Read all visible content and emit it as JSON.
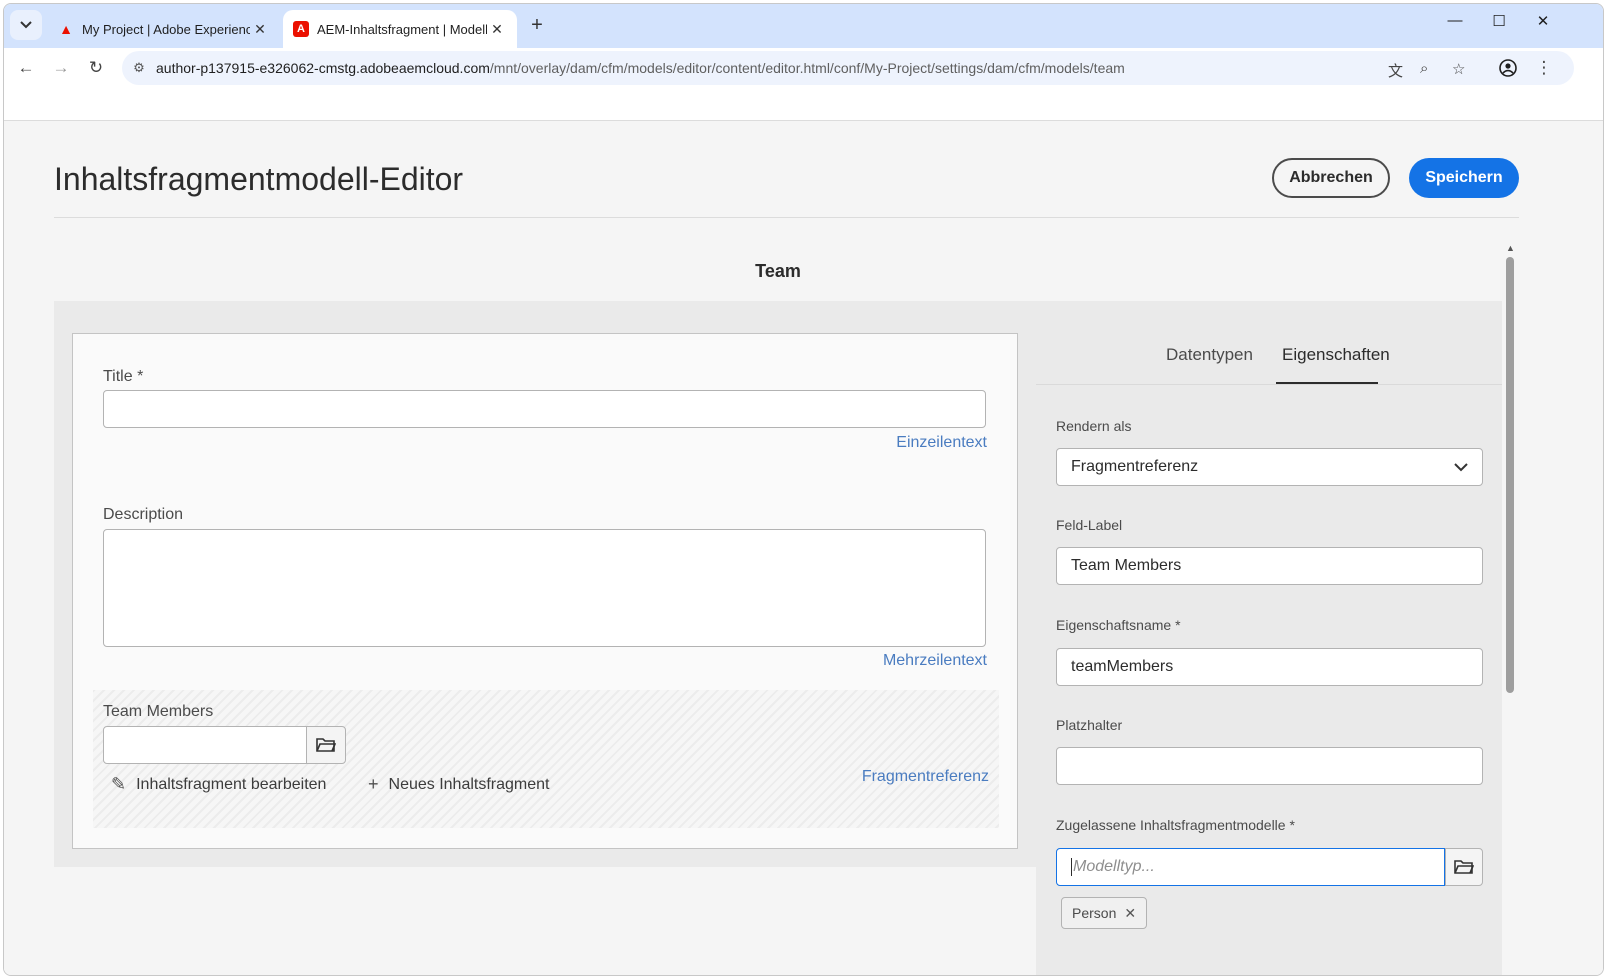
{
  "browser": {
    "tabs": [
      {
        "title": "My Project | Adobe Experience",
        "active": false
      },
      {
        "title": "AEM-Inhaltsfragment | Modell-E",
        "active": true
      }
    ],
    "url_host": "author-p137915-e326062-cmstg.adobeaemcloud.com",
    "url_path": "/mnt/overlay/dam/cfm/models/editor/content/editor.html/conf/My-Project/settings/dam/cfm/models/team",
    "icons": {
      "minimize": "—",
      "maximize": "☐",
      "close": "✕",
      "newtab": "+",
      "back": "←",
      "forward": "→",
      "reload": "↻"
    }
  },
  "app": {
    "title": "Inhaltsfragmentmodell-Editor",
    "cancel_label": "Abbrechen",
    "save_label": "Speichern",
    "accent_color": "#1473e6",
    "model_name": "Team"
  },
  "canvas": {
    "fields": [
      {
        "label": "Title *",
        "type": "Einzeilentext",
        "value": ""
      },
      {
        "label": "Description",
        "type": "Mehrzeilentext",
        "value": ""
      },
      {
        "label": "Team Members",
        "type": "Fragmentreferenz",
        "value": ""
      }
    ],
    "edit_fragment_label": "Inhaltsfragment bearbeiten",
    "new_fragment_label": "Neues Inhaltsfragment"
  },
  "panel": {
    "tabs": [
      "Datentypen",
      "Eigenschaften"
    ],
    "selected_tab": "Eigenschaften",
    "render_as_label": "Rendern als",
    "render_as_value": "Fragmentreferenz",
    "field_label_label": "Feld-Label",
    "field_label_value": "Team Members",
    "property_name_label": "Eigenschaftsname *",
    "property_name_value": "teamMembers",
    "placeholder_label": "Platzhalter",
    "placeholder_value": "",
    "allowed_models_label": "Zugelassene Inhaltsfragmentmodelle *",
    "allowed_models_placeholder": "Modelltyp...",
    "allowed_models_tags": [
      "Person"
    ]
  }
}
